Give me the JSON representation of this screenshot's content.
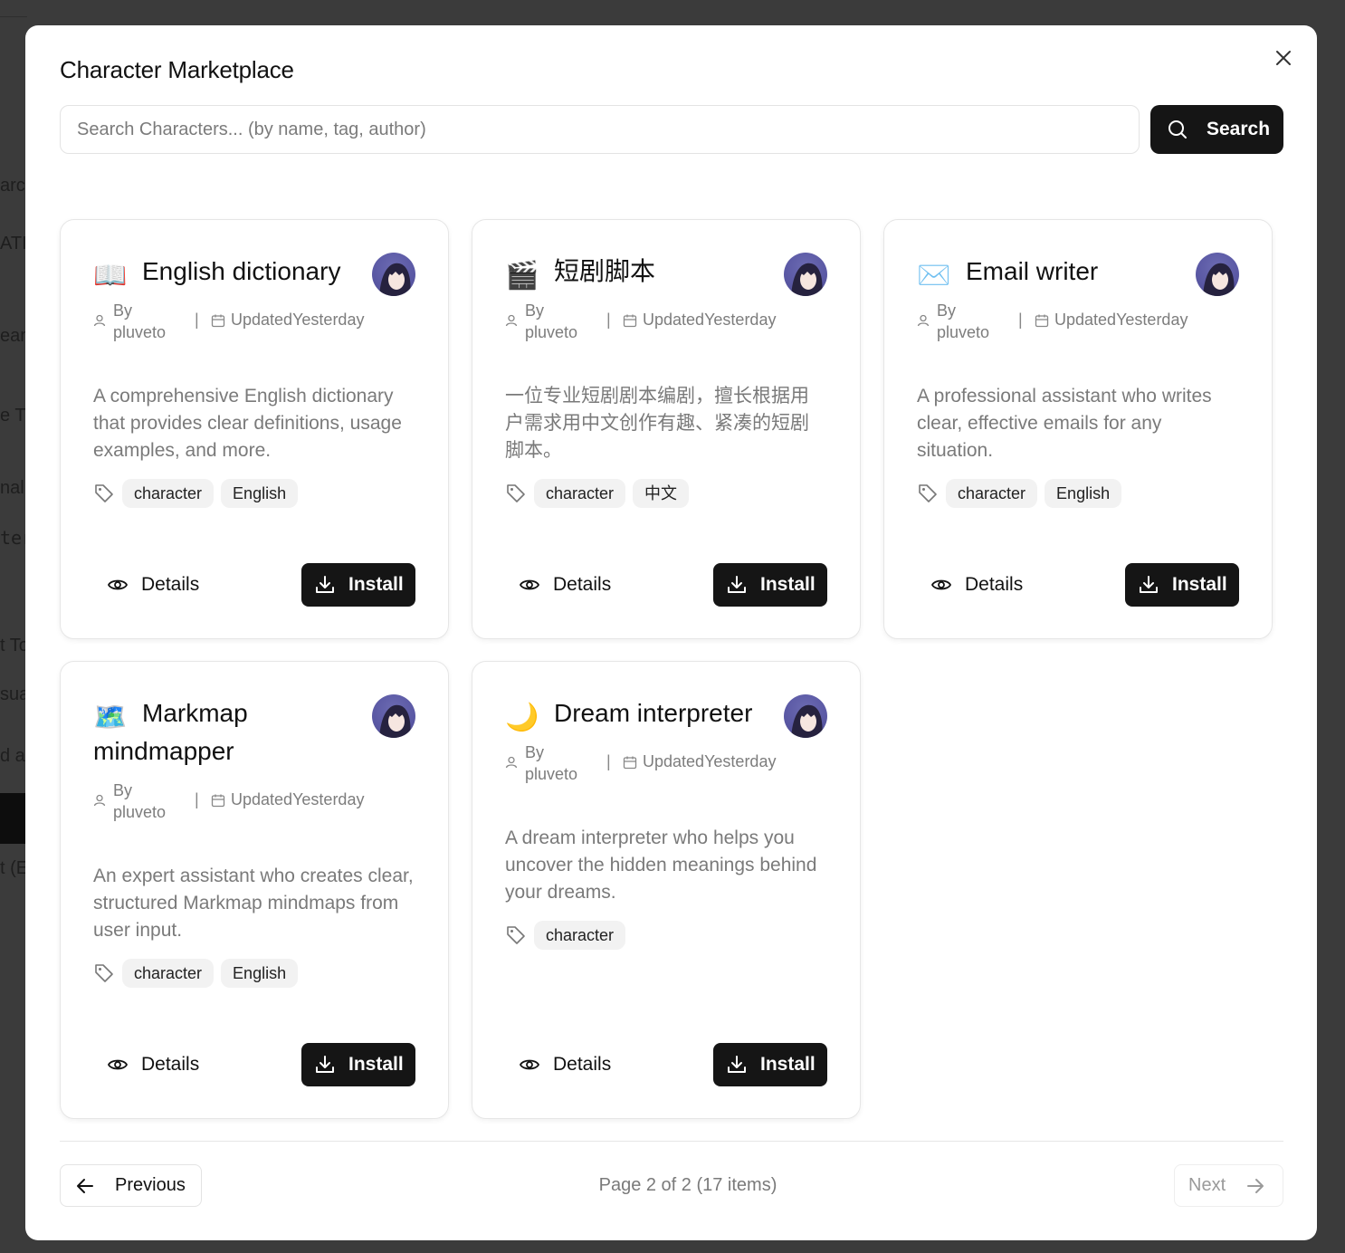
{
  "background": {
    "fragments": [
      "arch",
      "ATI",
      "eam",
      "e Tr",
      "nal",
      "ter",
      "t To",
      "sua",
      "d a",
      "t (E"
    ]
  },
  "modal": {
    "title": "Character Marketplace",
    "close_icon": "close-icon"
  },
  "search": {
    "placeholder": "Search Characters... (by name, tag, author)",
    "value": "",
    "button_label": "Search"
  },
  "cards": [
    {
      "emoji": "📖",
      "title": "English dictionary",
      "by_label": "By",
      "author": "pluveto",
      "updated_label": "Updated",
      "updated_value": "Yesterday",
      "description": "A comprehensive English dictionary that provides clear definitions, usage examples, and more.",
      "tags": [
        "character",
        "English"
      ],
      "details_label": "Details",
      "install_label": "Install"
    },
    {
      "emoji": "🎬",
      "title": "短剧脚本",
      "by_label": "By",
      "author": "pluveto",
      "updated_label": "Updated",
      "updated_value": "Yesterday",
      "description": "一位专业短剧剧本编剧，擅长根据用户需求用中文创作有趣、紧凑的短剧脚本。",
      "tags": [
        "character",
        "中文"
      ],
      "details_label": "Details",
      "install_label": "Install"
    },
    {
      "emoji": "✉️",
      "title": "Email writer",
      "by_label": "By",
      "author": "pluveto",
      "updated_label": "Updated",
      "updated_value": "Yesterday",
      "description": "A professional assistant who writes clear, effective emails for any situation.",
      "tags": [
        "character",
        "English"
      ],
      "details_label": "Details",
      "install_label": "Install"
    },
    {
      "emoji": "🗺️",
      "title": "Markmap mindmapper",
      "by_label": "By",
      "author": "pluveto",
      "updated_label": "Updated",
      "updated_value": "Yesterday",
      "description": "An expert assistant who creates clear, structured Markmap mindmaps from user input.",
      "tags": [
        "character",
        "English"
      ],
      "details_label": "Details",
      "install_label": "Install"
    },
    {
      "emoji": "🌙",
      "title": "Dream interpreter",
      "by_label": "By",
      "author": "pluveto",
      "updated_label": "Updated",
      "updated_value": "Yesterday",
      "description": "A dream interpreter who helps you uncover the hidden meanings behind your dreams.",
      "tags": [
        "character"
      ],
      "details_label": "Details",
      "install_label": "Install"
    }
  ],
  "pagination": {
    "previous_label": "Previous",
    "page_info": "Page 2 of 2 (17 items)",
    "next_label": "Next"
  }
}
